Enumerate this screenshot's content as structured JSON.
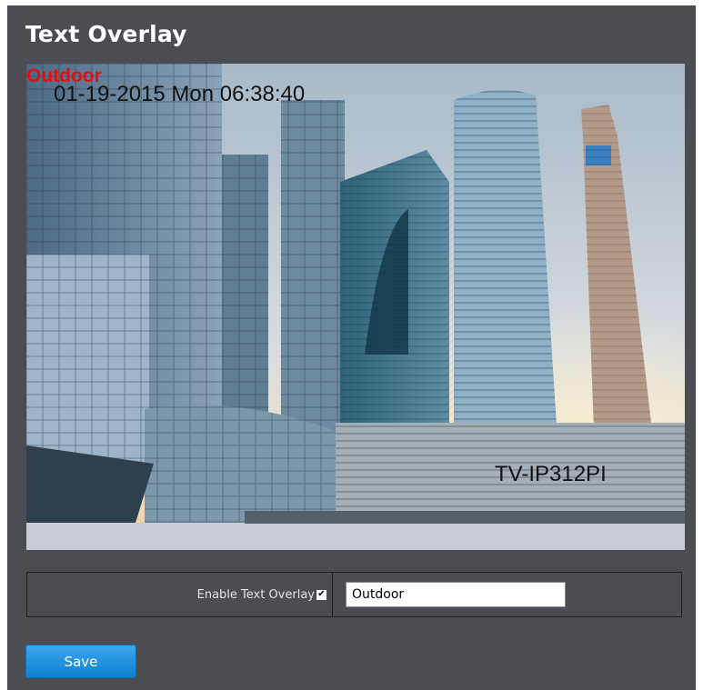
{
  "page": {
    "title": "Text Overlay"
  },
  "preview": {
    "overlay_name": "Outdoor",
    "overlay_datetime": "01-19-2015 Mon  06:38:40",
    "overlay_model": "TV-IP312PI"
  },
  "form": {
    "enable_label": "Enable Text Overlay",
    "enable_checked": true,
    "checkbox_glyph": "✔",
    "text_value": "Outdoor"
  },
  "actions": {
    "save_label": "Save"
  },
  "colors": {
    "panel_bg": "#4b4d53",
    "accent_blue": "#0e81d2",
    "overlay_name_color": "#e01010"
  }
}
